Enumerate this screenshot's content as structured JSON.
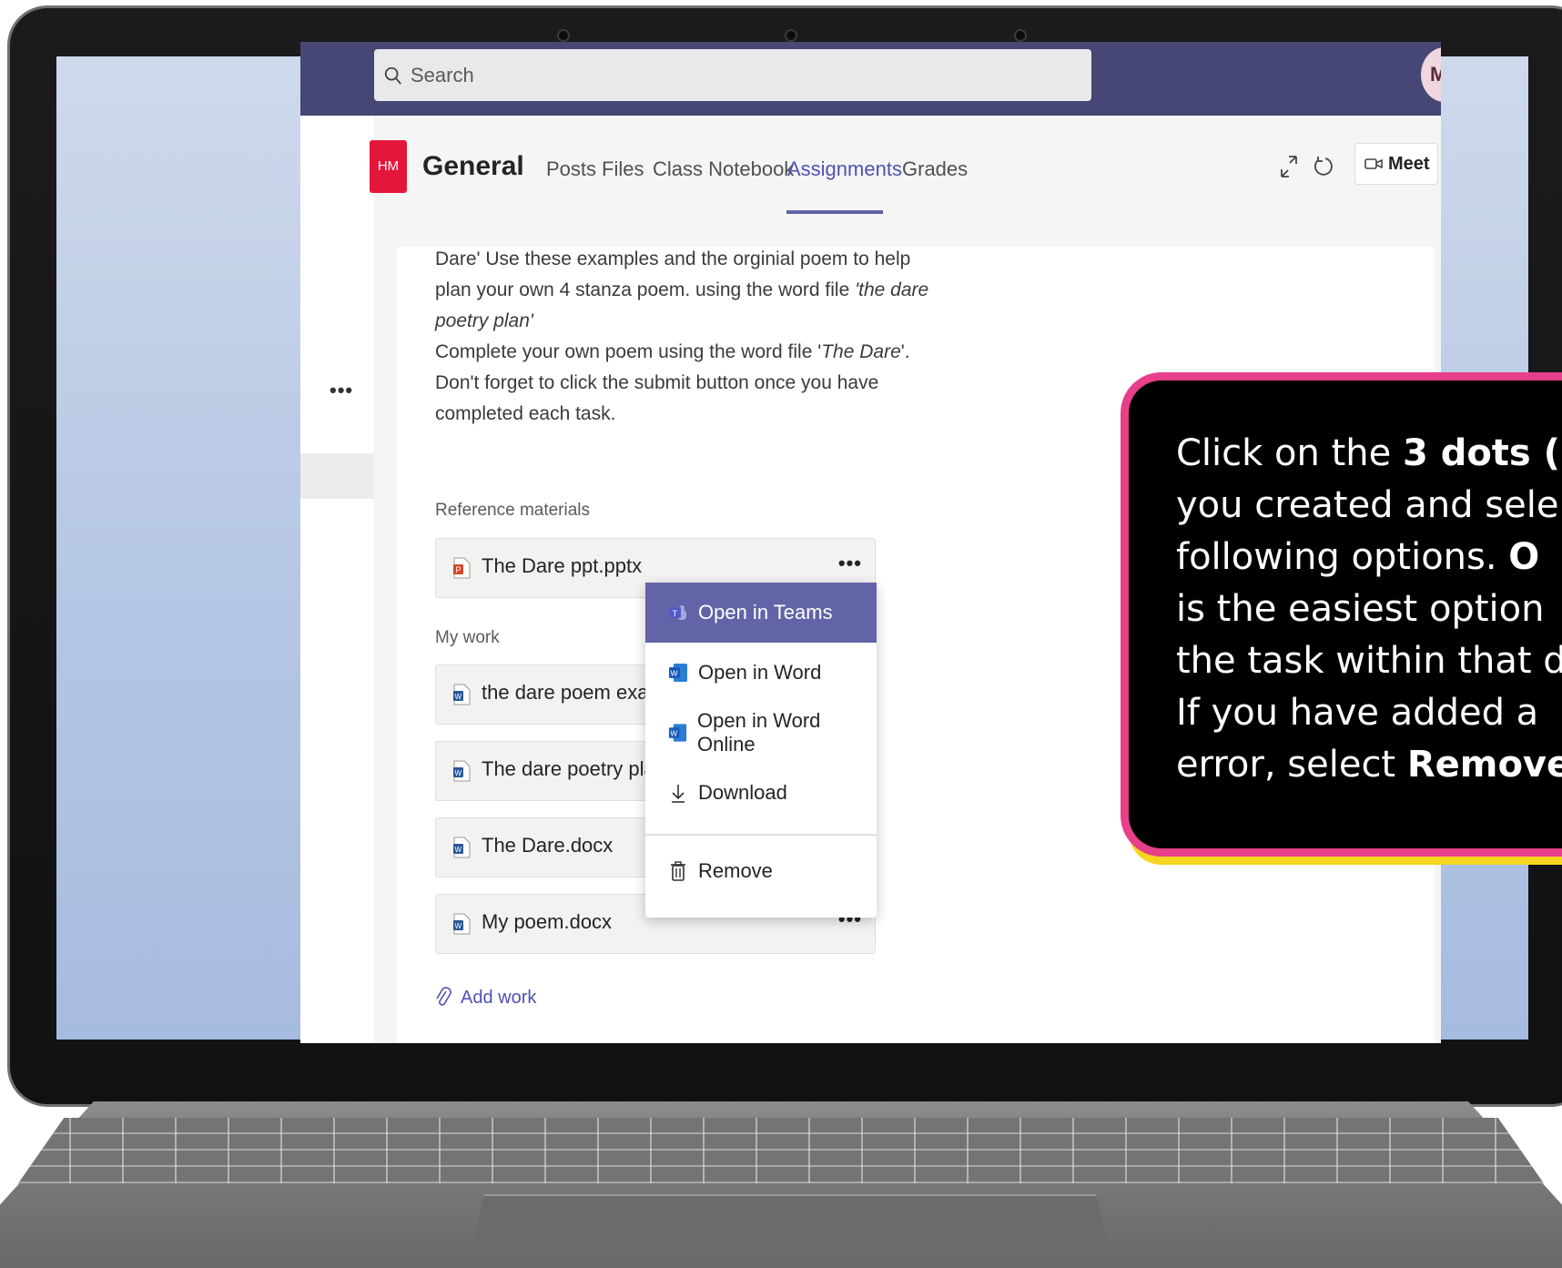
{
  "search": {
    "placeholder": "Search"
  },
  "user": {
    "avatar_initial": "M"
  },
  "team": {
    "badge": "HM",
    "channel_name": "General"
  },
  "tabs": [
    {
      "label": "Posts",
      "active": false
    },
    {
      "label": "Files",
      "active": false
    },
    {
      "label": "Class Notebook",
      "active": false
    },
    {
      "label": "Assignments",
      "active": true
    },
    {
      "label": "Grades",
      "active": false
    }
  ],
  "meet": {
    "label": "Meet"
  },
  "assignment": {
    "line1": "Dare'  Use these examples and the orginial poem to help",
    "line2_prefix": "plan your own 4 stanza poem. using the word file ",
    "line2_italic": "'the dare",
    "line3_italic": "poetry plan'",
    "line4_prefix": "Complete your own poem using the word file '",
    "line4_italic": "The Dare",
    "line4_suffix": "'.",
    "line5": "Don't forget to click the submit button once you have",
    "line6": "completed each task."
  },
  "reference": {
    "heading": "Reference materials",
    "files": [
      {
        "name": "The Dare ppt.pptx",
        "type": "pptx"
      }
    ]
  },
  "my_work": {
    "heading": "My work",
    "files": [
      {
        "name": "the dare poem examp",
        "type": "docx"
      },
      {
        "name": "The dare poetry plan.",
        "type": "docx"
      },
      {
        "name": "The Dare.docx",
        "type": "docx"
      },
      {
        "name": "My poem.docx",
        "type": "docx"
      }
    ],
    "add_label": "Add work"
  },
  "more_label": "•••",
  "context_menu": {
    "items": [
      {
        "label": "Open in Teams",
        "icon": "teams-icon",
        "highlighted": true
      },
      {
        "label": "Open in Word",
        "icon": "word-icon"
      },
      {
        "label": "Open in Word Online",
        "icon": "word-icon"
      },
      {
        "label": "Download",
        "icon": "download-icon"
      },
      {
        "label": "Remove",
        "icon": "trash-icon"
      }
    ]
  },
  "callout": {
    "l1_prefix": "Click on the ",
    "l1_bold": "3 dots (",
    "l2": "you created and sele",
    "l3_prefix": "following options.  ",
    "l3_bold": "O",
    "l4": "is the easiest option",
    "l5": "the task within that d",
    "l6": "If you have added a",
    "l7_prefix": "error, select ",
    "l7_bold": "Remove",
    "border_color": "#e73f8a",
    "glow_color": "#f6d51f"
  },
  "colors": {
    "teams_purple": "#464775",
    "accent": "#6264a7",
    "badge_red": "#e4173a"
  }
}
